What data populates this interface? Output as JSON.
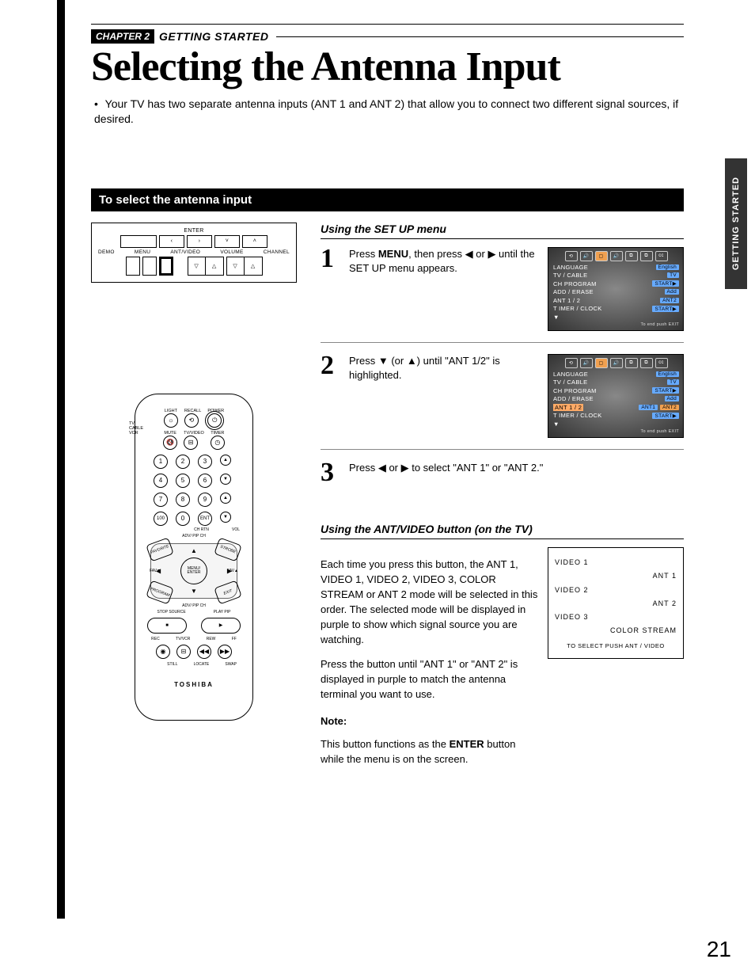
{
  "sideTab": "GETTING STARTED",
  "chapter": {
    "badge": "CHAPTER 2",
    "label": "GETTING STARTED"
  },
  "title": "Selecting the Antenna Input",
  "intro": "Your TV has two separate antenna inputs (ANT 1 and ANT 2) that allow you to connect two different signal sources, if desired.",
  "sectionBar": "To select the antenna input",
  "topPanel": {
    "enter": "ENTER",
    "volume": "VOLUME",
    "channel": "CHANNEL",
    "labels": [
      "DEMO",
      "MENU",
      "ANT/VIDEO"
    ],
    "down": "▼",
    "up": "▲"
  },
  "remote": {
    "sideLabels": [
      "TV",
      "CABLE",
      "VCR"
    ],
    "row1Labels": [
      "LIGHT",
      "RECALL",
      "POWER"
    ],
    "row2Labels": [
      "MUTE",
      "TV/VIDEO",
      "TIMER"
    ],
    "numbers": [
      "1",
      "2",
      "3",
      "4",
      "5",
      "6",
      "7",
      "8",
      "9",
      "100",
      "0",
      "ENT"
    ],
    "ch": "CH",
    "vol": "VOL",
    "chrtn": "CH RTN",
    "rockerTop": "ADV/ PIP CH",
    "rockerBottom": "ADV/ PIP CH",
    "center": "MENU/\nENTER",
    "favL": "FAV▼",
    "favR": "FAV▲",
    "cornerTL": "FAVORITE",
    "cornerTR": "STROBE",
    "cornerBL": "PROGRAM",
    "cornerBR": "EXIT",
    "pipRow1": [
      "STOP SOURCE",
      "PLAY PIP"
    ],
    "pipRow2": [
      "REC",
      "TV/VCR",
      "REW",
      "FF"
    ],
    "pipRow3": [
      "STILL",
      "LOCATE",
      "SWAP"
    ],
    "brand": "TOSHIBA"
  },
  "setup": {
    "heading": "Using the SET UP menu",
    "steps": [
      {
        "num": "1",
        "text_a": "Press ",
        "bold1": "MENU",
        "text_b": ", then press ◀ or ▶ until the SET UP menu appears."
      },
      {
        "num": "2",
        "text_a": "Press ▼ (or ▲)  until \"ANT 1/2\" is highlighted."
      },
      {
        "num": "3",
        "text_a": "Press ◀ or ▶ to select \"ANT 1\" or \"ANT 2.\""
      }
    ]
  },
  "osd": {
    "icons": [
      "⟲",
      "🔊",
      "▢",
      "🔊",
      "⧉",
      "⧉",
      "cc"
    ],
    "lines": [
      {
        "label": "LANGUAGE",
        "value": "English"
      },
      {
        "label": "TV / CABLE",
        "value": "TV"
      },
      {
        "label": "CH  PROGRAM",
        "value": "START▶"
      },
      {
        "label": "ADD / ERASE",
        "value": "Add"
      },
      {
        "label": "ANT 1 / 2",
        "value": "ANT2"
      },
      {
        "label": "T IMER / CLOCK",
        "value": "START▶"
      }
    ],
    "ant_sel": {
      "label": "ANT 1 / 2",
      "v1": "ANT1",
      "v2": "ANT2"
    },
    "footer": "To end push  EXIT",
    "arrowDown": "▼"
  },
  "antVideo": {
    "heading": "Using the ANT/VIDEO button (on the TV)",
    "para1": "Each time you press this button, the ANT 1, VIDEO 1, VIDEO 2, VIDEO 3, COLOR STREAM or ANT 2 mode will be selected in this order. The selected mode will be displayed in purple to show which signal source you are watching.",
    "para2": "Press the button until \"ANT 1\" or \"ANT 2\" is displayed in purple to match the antenna terminal you want to use.",
    "noteHead": "Note:",
    "noteBody_a": "This button functions as the ",
    "noteBold": "ENTER",
    "noteBody_b": " button while the menu is on the screen."
  },
  "vidPanel": {
    "left": [
      "VIDEO 1",
      "VIDEO 2",
      "VIDEO 3"
    ],
    "right": [
      "ANT 1",
      "ANT 2",
      "COLOR STREAM"
    ],
    "footer": "TO SELECT PUSH ANT / VIDEO"
  },
  "pageNumber": "21"
}
